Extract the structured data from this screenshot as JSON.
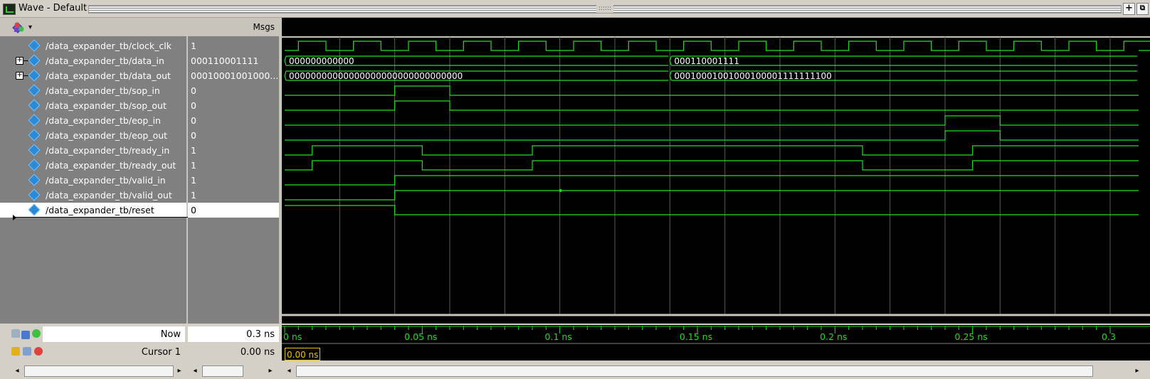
{
  "window": {
    "title": "Wave - Default"
  },
  "header": {
    "msgs_label": "Msgs"
  },
  "signals": [
    {
      "name": "/data_expander_tb/clock_clk",
      "value": "1",
      "expandable": false
    },
    {
      "name": "/data_expander_tb/data_in",
      "value": "000110001111",
      "expandable": true
    },
    {
      "name": "/data_expander_tb/data_out",
      "value": "00010001001000...",
      "expandable": true
    },
    {
      "name": "/data_expander_tb/sop_in",
      "value": "0",
      "expandable": false
    },
    {
      "name": "/data_expander_tb/sop_out",
      "value": "0",
      "expandable": false
    },
    {
      "name": "/data_expander_tb/eop_in",
      "value": "0",
      "expandable": false
    },
    {
      "name": "/data_expander_tb/eop_out",
      "value": "0",
      "expandable": false
    },
    {
      "name": "/data_expander_tb/ready_in",
      "value": "1",
      "expandable": false
    },
    {
      "name": "/data_expander_tb/ready_out",
      "value": "1",
      "expandable": false
    },
    {
      "name": "/data_expander_tb/valid_in",
      "value": "1",
      "expandable": false
    },
    {
      "name": "/data_expander_tb/valid_out",
      "value": "1",
      "expandable": false
    },
    {
      "name": "/data_expander_tb/reset",
      "value": "0",
      "expandable": false,
      "selected": true
    }
  ],
  "bus_values": {
    "data_in": [
      "000000000000",
      "000110001111"
    ],
    "data_out": [
      "00000000000000000000000000000000",
      "00010001001000100001111111100"
    ]
  },
  "status": {
    "now_label": "Now",
    "now_value": "0.3 ns",
    "cursor_label": "Cursor 1",
    "cursor_value": "0.00 ns",
    "cursor_readout": "0.00 ns"
  },
  "timeline": {
    "labels": [
      "0 ns",
      "0.05 ns",
      "0.1 ns",
      "0.15 ns",
      "0.2 ns",
      "0.25 ns",
      "0.3"
    ],
    "start_ns": 0,
    "end_ns": 0.3
  },
  "colors": {
    "wave": "#22dd22",
    "background": "#000000",
    "cursor": "#e8c800",
    "grid": "#5a5a5a"
  }
}
